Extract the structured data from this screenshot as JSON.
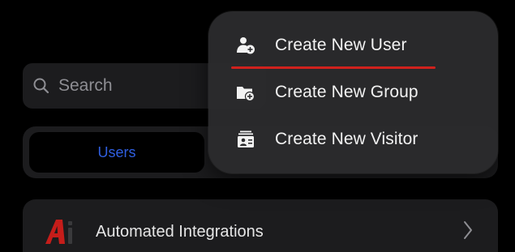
{
  "search": {
    "placeholder": "Search"
  },
  "segment": {
    "selected_tab": "Users",
    "accent": "#2f5fe0"
  },
  "list": [
    {
      "label": "Automated Integrations",
      "icon": "ai-logo-icon"
    }
  ],
  "menu": {
    "items": [
      {
        "label": "Create New User",
        "icon": "add-user-icon"
      },
      {
        "label": "Create New Group",
        "icon": "add-folder-icon"
      },
      {
        "label": "Create New Visitor",
        "icon": "visitor-badge-icon"
      }
    ],
    "highlight_color": "#d0211d"
  }
}
